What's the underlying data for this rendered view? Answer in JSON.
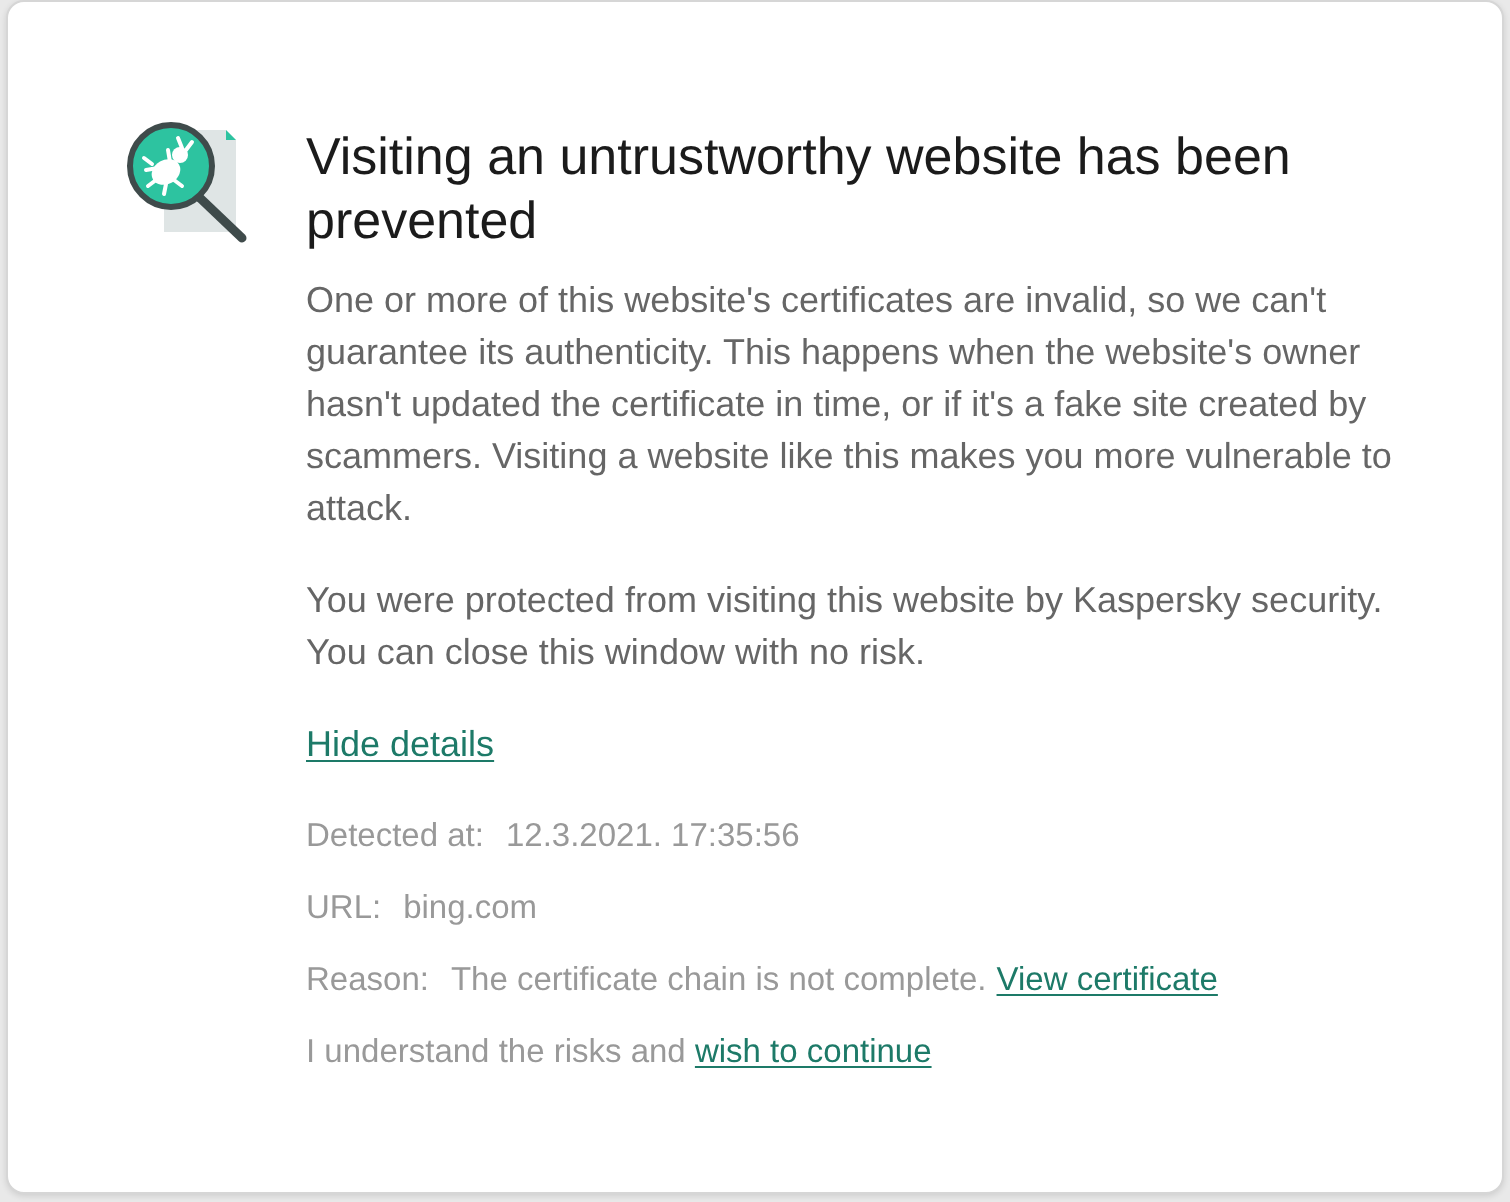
{
  "dialog": {
    "title": "Visiting an untrustworthy website has been prevented",
    "paragraphs": [
      "One or more of this website's certificates are invalid, so we can't guarantee its authenticity. This happens when the website's owner hasn't updated the certificate in time, or if it's a fake site created by scammers. Visiting a website like this makes you more vulnerable to attack.",
      "You were protected from visiting this website by Kaspersky security. You can close this window with no risk."
    ],
    "details_link": "Hide details",
    "details": [
      {
        "label": "Detected at:",
        "value": "12.3.2021. 17:35:56"
      },
      {
        "label": "URL:",
        "value": "bing.com"
      },
      {
        "label": "Reason:",
        "value": "The certificate chain is not complete.",
        "link": "View certificate"
      }
    ],
    "continue": {
      "text": "I understand the risks and",
      "link": "wish to continue"
    }
  }
}
